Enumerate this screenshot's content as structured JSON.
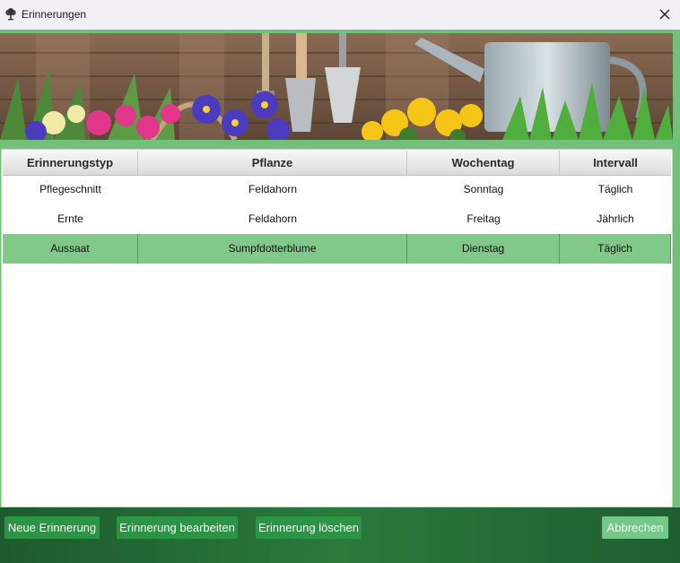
{
  "window": {
    "title": "Erinnerungen",
    "app_icon": "tree-icon",
    "close_icon": "close-icon"
  },
  "banner": {
    "description_icon": "garden-banner-image"
  },
  "table": {
    "headers": [
      "Erinnerungstyp",
      "Pflanze",
      "Wochentag",
      "Intervall"
    ],
    "rows": [
      [
        "Pflegeschnitt",
        "Feldahorn",
        "Sonntag",
        "Täglich"
      ],
      [
        "Ernte",
        "Feldahorn",
        "Freitag",
        "Jährlich"
      ],
      [
        "Aussaat",
        "Sumpfdotterblume",
        "Dienstag",
        "Täglich"
      ]
    ],
    "selected_row_index": 2
  },
  "buttons": {
    "new": "Neue Erinnerung",
    "edit": "Erinnerung bearbeiten",
    "delete": "Erinnerung löschen",
    "cancel": "Abbrechen"
  },
  "colors": {
    "accent_green": "#2b9445",
    "selected_row": "#80c98a",
    "frame_green": "#73c07a",
    "bottom_bar": "#1f5e30"
  }
}
